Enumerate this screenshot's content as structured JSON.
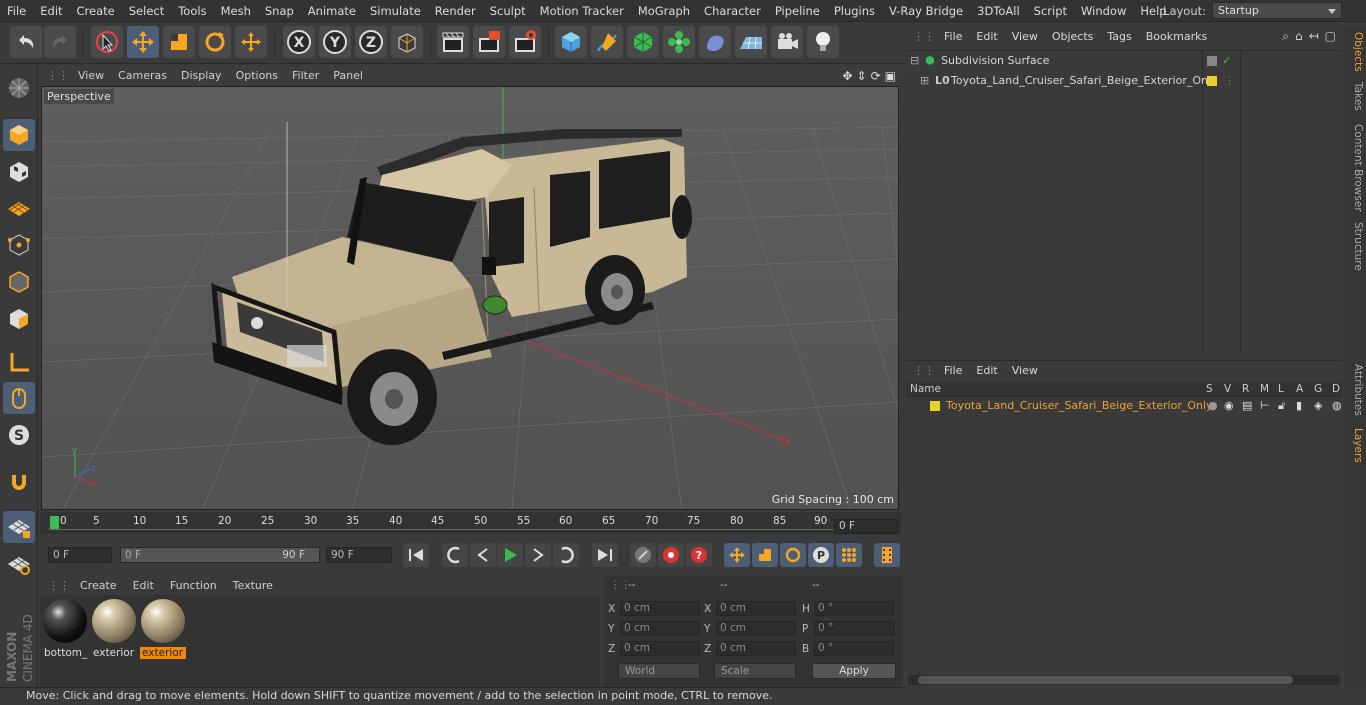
{
  "menu": [
    "File",
    "Edit",
    "Create",
    "Select",
    "Tools",
    "Mesh",
    "Snap",
    "Animate",
    "Simulate",
    "Render",
    "Sculpt",
    "Motion Tracker",
    "MoGraph",
    "Character",
    "Pipeline",
    "Plugins",
    "V-Ray Bridge",
    "3DToAll",
    "Script",
    "Window",
    "Help"
  ],
  "layout": {
    "label": "Layout:",
    "value": "Startup"
  },
  "viewport": {
    "menu": [
      "View",
      "Cameras",
      "Display",
      "Options",
      "Filter",
      "Panel"
    ],
    "camera_label": "Perspective",
    "grid_spacing": "Grid Spacing : 100 cm"
  },
  "timeline": {
    "ticks": [
      "0",
      "5",
      "10",
      "15",
      "20",
      "25",
      "30",
      "35",
      "40",
      "45",
      "50",
      "55",
      "60",
      "65",
      "70",
      "75",
      "80",
      "85",
      "90"
    ],
    "current_frame": "0 F",
    "start_field": "0 F",
    "range_start": "0 F",
    "range_end": "90 F",
    "end_field": "90 F"
  },
  "materials": {
    "menu": [
      "Create",
      "Edit",
      "Function",
      "Texture"
    ],
    "items": [
      {
        "name": "bottom_",
        "selected": false
      },
      {
        "name": "exterior",
        "selected": false
      },
      {
        "name": "exterior",
        "selected": true
      }
    ]
  },
  "coordinates": {
    "headers": [
      "--",
      "--",
      "--"
    ],
    "rows": [
      {
        "a": "X",
        "av": "0 cm",
        "b": "X",
        "bv": "0 cm",
        "c": "H",
        "cv": "0 °"
      },
      {
        "a": "Y",
        "av": "0 cm",
        "b": "Y",
        "bv": "0 cm",
        "c": "P",
        "cv": "0 °"
      },
      {
        "a": "Z",
        "av": "0 cm",
        "b": "Z",
        "bv": "0 cm",
        "c": "B",
        "cv": "0 °"
      }
    ],
    "space": "World",
    "mode": "Scale",
    "apply": "Apply"
  },
  "status": "Move: Click and drag to move elements. Hold down SHIFT to quantize movement / add to the selection in point mode, CTRL to remove.",
  "objects": {
    "menu": [
      "File",
      "Edit",
      "View",
      "Objects",
      "Tags",
      "Bookmarks"
    ],
    "items": [
      {
        "name": "Subdivision Surface"
      },
      {
        "name": "Toyota_Land_Cruiser_Safari_Beige_Exterior_Only"
      }
    ]
  },
  "layers": {
    "menu": [
      "File",
      "Edit",
      "View"
    ],
    "headers": [
      "Name",
      "S",
      "V",
      "R",
      "M",
      "L",
      "A",
      "G",
      "D"
    ],
    "items": [
      {
        "name": "Toyota_Land_Cruiser_Safari_Beige_Exterior_Only"
      }
    ]
  },
  "right_tabs": [
    "Objects",
    "Takes",
    "Content Browser",
    "Structure",
    "Attributes",
    "Layers"
  ],
  "brand": [
    "MAXON",
    "CINEMA 4D"
  ],
  "colors": {
    "accent": "#f08a00",
    "active_tool": "#4d5e77",
    "layer_color": "#e8d22a",
    "car_body": "#c9b896"
  }
}
